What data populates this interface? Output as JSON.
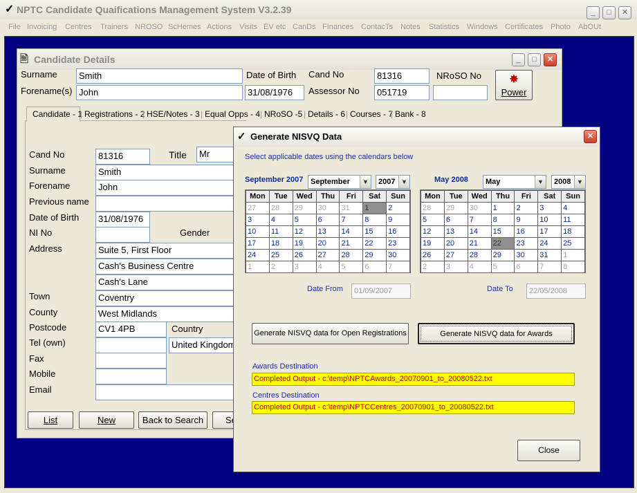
{
  "app": {
    "title": "NPTC Candidate Quaifications Management System V3.2.39"
  },
  "menu": [
    "File",
    "Invoicing",
    "Centres",
    "Trainers",
    "NROSO",
    "ScHemes",
    "Actions",
    "Visits",
    "EV etc",
    "CanDs",
    "FInances",
    "ContacTs",
    "Notes",
    "Statistics",
    "Windows",
    "Certificates",
    "Photo",
    "AbOUt"
  ],
  "colors": {
    "desktop": "#000080",
    "highlight": "#ffff00",
    "dest_text": "#c00000",
    "link": "#1a2eb0"
  },
  "candidate": {
    "title": "Candidate Details",
    "labels": {
      "surname": "Surname",
      "forenames": "Forename(s)",
      "dob": "Date of Birth",
      "cand_no": "Cand No",
      "assessor_no": "Assessor No",
      "nroso_no": "NRoSO No",
      "power": "Power"
    },
    "values": {
      "surname": "Smith",
      "forenames": "John",
      "dob": "31/08/1976",
      "cand_no": "81316",
      "assessor_no": "051719",
      "nroso_no": ""
    },
    "tabs": [
      "Candidate - 1",
      "Registrations - 2",
      "HSE/Notes - 3",
      "Equal Opps - 4",
      "NRoSO -5",
      "Details - 6",
      "Courses - 7",
      "Bank - 8"
    ],
    "form": {
      "labels": {
        "cand_no": "Cand No",
        "title": "Title",
        "surname": "Surname",
        "forename": "Forename",
        "previous_name": "Previous name",
        "dob": "Date of Birth",
        "ni_no": "NI No",
        "gender": "Gender",
        "address": "Address",
        "town": "Town",
        "county": "County",
        "postcode": "Postcode",
        "country": "Country",
        "tel": "Tel (own)",
        "fax": "Fax",
        "mobile": "Mobile",
        "email": "Email"
      },
      "values": {
        "cand_no": "81316",
        "title": "Mr",
        "surname": "Smith",
        "forename": "John",
        "previous_name": "",
        "dob": "31/08/1976",
        "ni_no": "",
        "address1": "Suite 5, First Floor",
        "address2": "Cash's Business Centre",
        "address3": "Cash's Lane",
        "town": "Coventry",
        "county": "West Midlands",
        "postcode": "CV1 4PB",
        "country": "United Kingdom",
        "tel": "",
        "fax": "",
        "mobile": "",
        "email": ""
      }
    },
    "buttons": {
      "list": "List",
      "new": "New",
      "back": "Back to Search",
      "more": "Se"
    }
  },
  "nisvq": {
    "title": "Generate NISVQ Data",
    "instruction": "Select applicable dates using the calendars below",
    "weekdays": [
      "Mon",
      "Tue",
      "Wed",
      "Thu",
      "Fri",
      "Sat",
      "Sun"
    ],
    "cal1": {
      "heading": "September 2007",
      "month": "September",
      "year": "2007",
      "selected": "1",
      "rows": [
        [
          "27",
          "28",
          "29",
          "30",
          "31",
          "1",
          "2"
        ],
        [
          "3",
          "4",
          "5",
          "6",
          "7",
          "8",
          "9"
        ],
        [
          "10",
          "11",
          "12",
          "13",
          "14",
          "15",
          "16"
        ],
        [
          "17",
          "18",
          "19",
          "20",
          "21",
          "22",
          "23"
        ],
        [
          "24",
          "25",
          "26",
          "27",
          "28",
          "29",
          "30"
        ],
        [
          "1",
          "2",
          "3",
          "4",
          "5",
          "6",
          "7"
        ]
      ]
    },
    "cal2": {
      "heading": "May 2008",
      "month": "May",
      "year": "2008",
      "selected": "22",
      "rows": [
        [
          "28",
          "29",
          "30",
          "1",
          "2",
          "3",
          "4"
        ],
        [
          "5",
          "6",
          "7",
          "8",
          "9",
          "10",
          "11"
        ],
        [
          "12",
          "13",
          "14",
          "15",
          "16",
          "17",
          "18"
        ],
        [
          "19",
          "20",
          "21",
          "22",
          "23",
          "24",
          "25"
        ],
        [
          "26",
          "27",
          "28",
          "29",
          "30",
          "31",
          "1"
        ],
        [
          "2",
          "3",
          "4",
          "5",
          "6",
          "7",
          "8"
        ]
      ]
    },
    "date_from_label": "Date From",
    "date_from": "01/09/2007",
    "date_to_label": "Date To",
    "date_to": "22/05/2008",
    "btn_open": "Generate NISVQ data for Open Registrations",
    "btn_awards": "Generate NISVQ data for Awards",
    "awards_dest_label": "Awards Destination",
    "awards_dest": "Completed Output - c:\\temp\\NPTCAwards_20070901_to_20080522.txt",
    "centres_dest_label": "Centres Destination",
    "centres_dest": "Completed Output - c:\\temp\\NPTCCentres_20070901_to_20080522.txt",
    "close": "Close"
  }
}
